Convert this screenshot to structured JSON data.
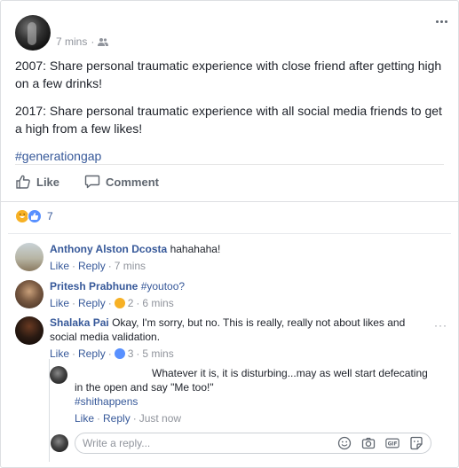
{
  "post": {
    "time": "7 mins",
    "separator": "·",
    "paragraphs": [
      "2007: Share personal traumatic experience with close friend after getting high on a few drinks!",
      "2017: Share personal traumatic experience with all social media friends to get a high from a few likes!"
    ],
    "hashtag": "#generationgap"
  },
  "actions": {
    "like": "Like",
    "comment": "Comment"
  },
  "reactions": {
    "count": "7",
    "types": [
      "haha-icon",
      "like-icon"
    ]
  },
  "comments": [
    {
      "name": "Anthony Alston Dcosta",
      "text": "hahahaha!",
      "like": "Like",
      "reply": "Reply",
      "time": "7 mins"
    },
    {
      "name": "Pritesh Prabhune",
      "tag": "#youtoo?",
      "like": "Like",
      "reply": "Reply",
      "react_count": "2",
      "time": "6 mins"
    },
    {
      "name": "Shalaka Pai",
      "text": "Okay, I'm sorry, but no. This is really, really not about likes and social media validation.",
      "like": "Like",
      "reply": "Reply",
      "react_count": "3",
      "time": "5 mins"
    }
  ],
  "reply": {
    "text": "Whatever it is, it is disturbing...may as well start defecating in the open and say \"Me too!\"",
    "tag": "#shithappens",
    "like": "Like",
    "reply": "Reply",
    "time": "Just now"
  },
  "reply_box": {
    "placeholder": "Write a reply..."
  },
  "colors": {
    "link": "#365899",
    "muted": "#90949c",
    "text": "#1d2129",
    "haha": "#f7b125",
    "like": "#5890ff"
  }
}
